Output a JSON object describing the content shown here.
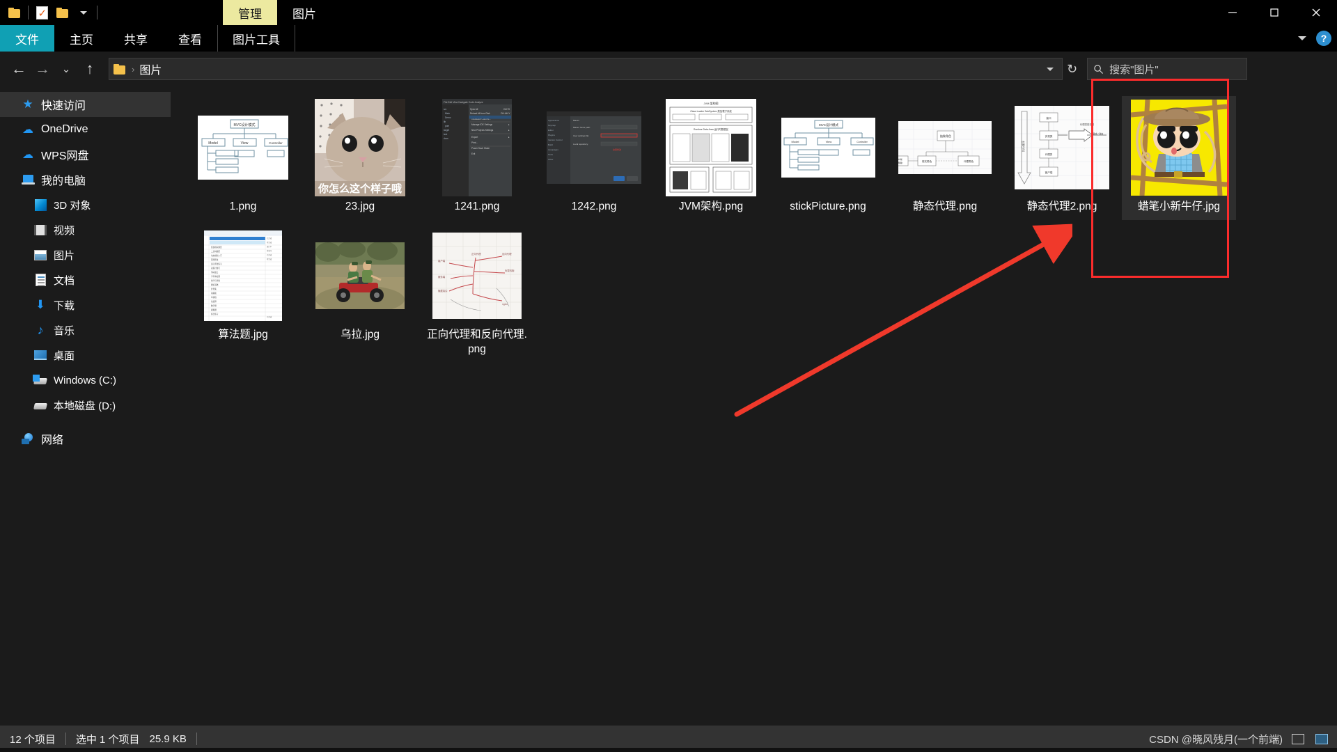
{
  "window": {
    "quick_access_icons": [
      "folder-icon",
      "save-doc-icon",
      "new-folder-icon",
      "dropdown-caret-icon"
    ],
    "contextual_tab": "管理",
    "contextual_group": "图片",
    "min_label": "最小化",
    "max_label": "最大化",
    "close_label": "关闭"
  },
  "ribbon": {
    "tabs": [
      {
        "label": "文件",
        "active": true
      },
      {
        "label": "主页",
        "active": false
      },
      {
        "label": "共享",
        "active": false
      },
      {
        "label": "查看",
        "active": false
      },
      {
        "label": "图片工具",
        "active": false
      }
    ],
    "collapse_icon": "chevron-down-icon",
    "help_label": "?"
  },
  "address_bar": {
    "back_icon": "←",
    "forward_icon": "→",
    "recent_icon": "⌄",
    "up_icon": "↑",
    "folder_icon": "folder-icon",
    "crumb_separator": "›",
    "path": "图片",
    "dropdown_icon": "chevron-down-icon",
    "refresh_icon": "↻",
    "search_icon": "search-icon",
    "search_placeholder": "搜索\"图片\""
  },
  "sidebar": {
    "items": [
      {
        "label": "快速访问",
        "icon": "star-icon",
        "indent": 0,
        "selected": true
      },
      {
        "label": "OneDrive",
        "icon": "onedrive-cloud-icon",
        "indent": 0,
        "selected": false
      },
      {
        "label": "WPS网盘",
        "icon": "wps-cloud-icon",
        "indent": 0,
        "selected": false
      },
      {
        "label": "我的电脑",
        "icon": "this-pc-icon",
        "indent": 0,
        "selected": false
      },
      {
        "label": "3D 对象",
        "icon": "3d-objects-icon",
        "indent": 1,
        "selected": false
      },
      {
        "label": "视频",
        "icon": "videos-icon",
        "indent": 1,
        "selected": false
      },
      {
        "label": "图片",
        "icon": "pictures-icon",
        "indent": 1,
        "selected": false
      },
      {
        "label": "文档",
        "icon": "documents-icon",
        "indent": 1,
        "selected": false
      },
      {
        "label": "下载",
        "icon": "downloads-icon",
        "indent": 1,
        "selected": false
      },
      {
        "label": "音乐",
        "icon": "music-icon",
        "indent": 1,
        "selected": false
      },
      {
        "label": "桌面",
        "icon": "desktop-icon",
        "indent": 1,
        "selected": false
      },
      {
        "label": "Windows (C:)",
        "icon": "windows-drive-icon",
        "indent": 1,
        "selected": false
      },
      {
        "label": "本地磁盘 (D:)",
        "icon": "local-disk-icon",
        "indent": 1,
        "selected": false
      },
      {
        "label": "网络",
        "icon": "network-icon",
        "indent": 0,
        "selected": false
      }
    ]
  },
  "files": [
    {
      "name": "1.png",
      "thumb": "diagram-mvc",
      "selected": false
    },
    {
      "name": "23.jpg",
      "thumb": "cat-photo",
      "selected": false
    },
    {
      "name": "1241.png",
      "thumb": "ide-menu",
      "selected": false
    },
    {
      "name": "1242.png",
      "thumb": "ide-dark",
      "selected": false
    },
    {
      "name": "JVM架构.png",
      "thumb": "jvm-chart",
      "selected": false
    },
    {
      "name": "stickPicture.png",
      "thumb": "diagram-mvc2",
      "selected": false
    },
    {
      "name": "静态代理.png",
      "thumb": "flow-light",
      "selected": false
    },
    {
      "name": "静态代理2.png",
      "thumb": "flow-arrow",
      "selected": false
    },
    {
      "name": "蜡笔小新牛仔.jpg",
      "thumb": "crayon-shinchan",
      "selected": true
    },
    {
      "name": "算法题.jpg",
      "thumb": "spreadsheet",
      "selected": false
    },
    {
      "name": "乌拉.jpg",
      "thumb": "motorbike-photo",
      "selected": false
    },
    {
      "name": "正向代理和反向代理.png",
      "thumb": "mindmap",
      "selected": false
    }
  ],
  "annotation": {
    "highlight_color": "#fb2c2c",
    "arrow_color": "#f0392b"
  },
  "status_bar": {
    "item_count": "12 个项目",
    "selection": "选中 1 个项目",
    "selection_size": "25.9 KB",
    "watermark": "CSDN @晓风残月(一个前端)",
    "view_list_icon": "details-view-icon",
    "view_tile_icon": "large-icons-view-icon"
  }
}
